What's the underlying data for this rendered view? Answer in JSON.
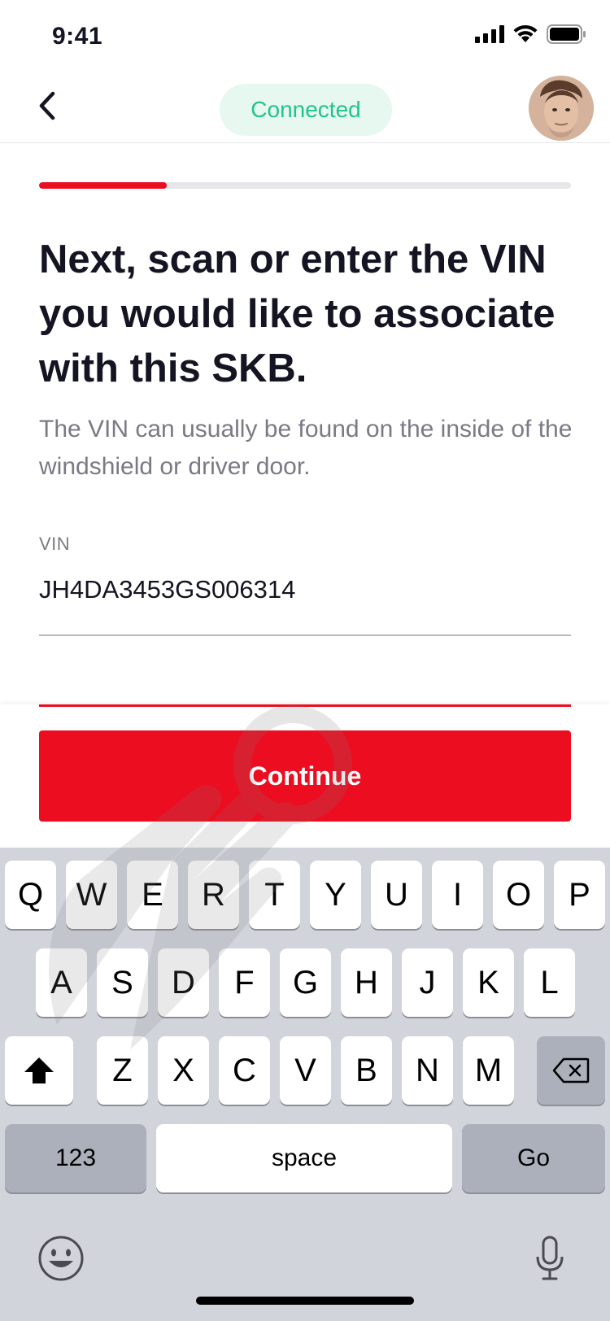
{
  "status_bar": {
    "time": "9:41"
  },
  "nav": {
    "connection_status": "Connected"
  },
  "progress": {
    "fraction": 0.24
  },
  "content": {
    "headline": "Next, scan or enter the VIN you would like to associate with this SKB.",
    "subtext": "The VIN can usually be found on the inside of the windshield or driver door.",
    "vin_label": "VIN",
    "vin_value": "JH4DA3453GS006314"
  },
  "actions": {
    "continue_label": "Continue"
  },
  "keyboard": {
    "row1": [
      "Q",
      "W",
      "E",
      "R",
      "T",
      "Y",
      "U",
      "I",
      "O",
      "P"
    ],
    "row2": [
      "A",
      "S",
      "D",
      "F",
      "G",
      "H",
      "J",
      "K",
      "L"
    ],
    "row3": [
      "Z",
      "X",
      "C",
      "V",
      "B",
      "N",
      "M"
    ],
    "numbers_label": "123",
    "space_label": "space",
    "go_label": "Go"
  },
  "colors": {
    "brand_red": "#ec0d21",
    "connected_green": "#23c489",
    "connected_bg": "#e6f8f0"
  },
  "icons": [
    "signal-icon",
    "wifi-icon",
    "battery-icon",
    "back-chevron-icon",
    "shift-icon",
    "delete-icon",
    "emoji-icon",
    "microphone-icon"
  ]
}
